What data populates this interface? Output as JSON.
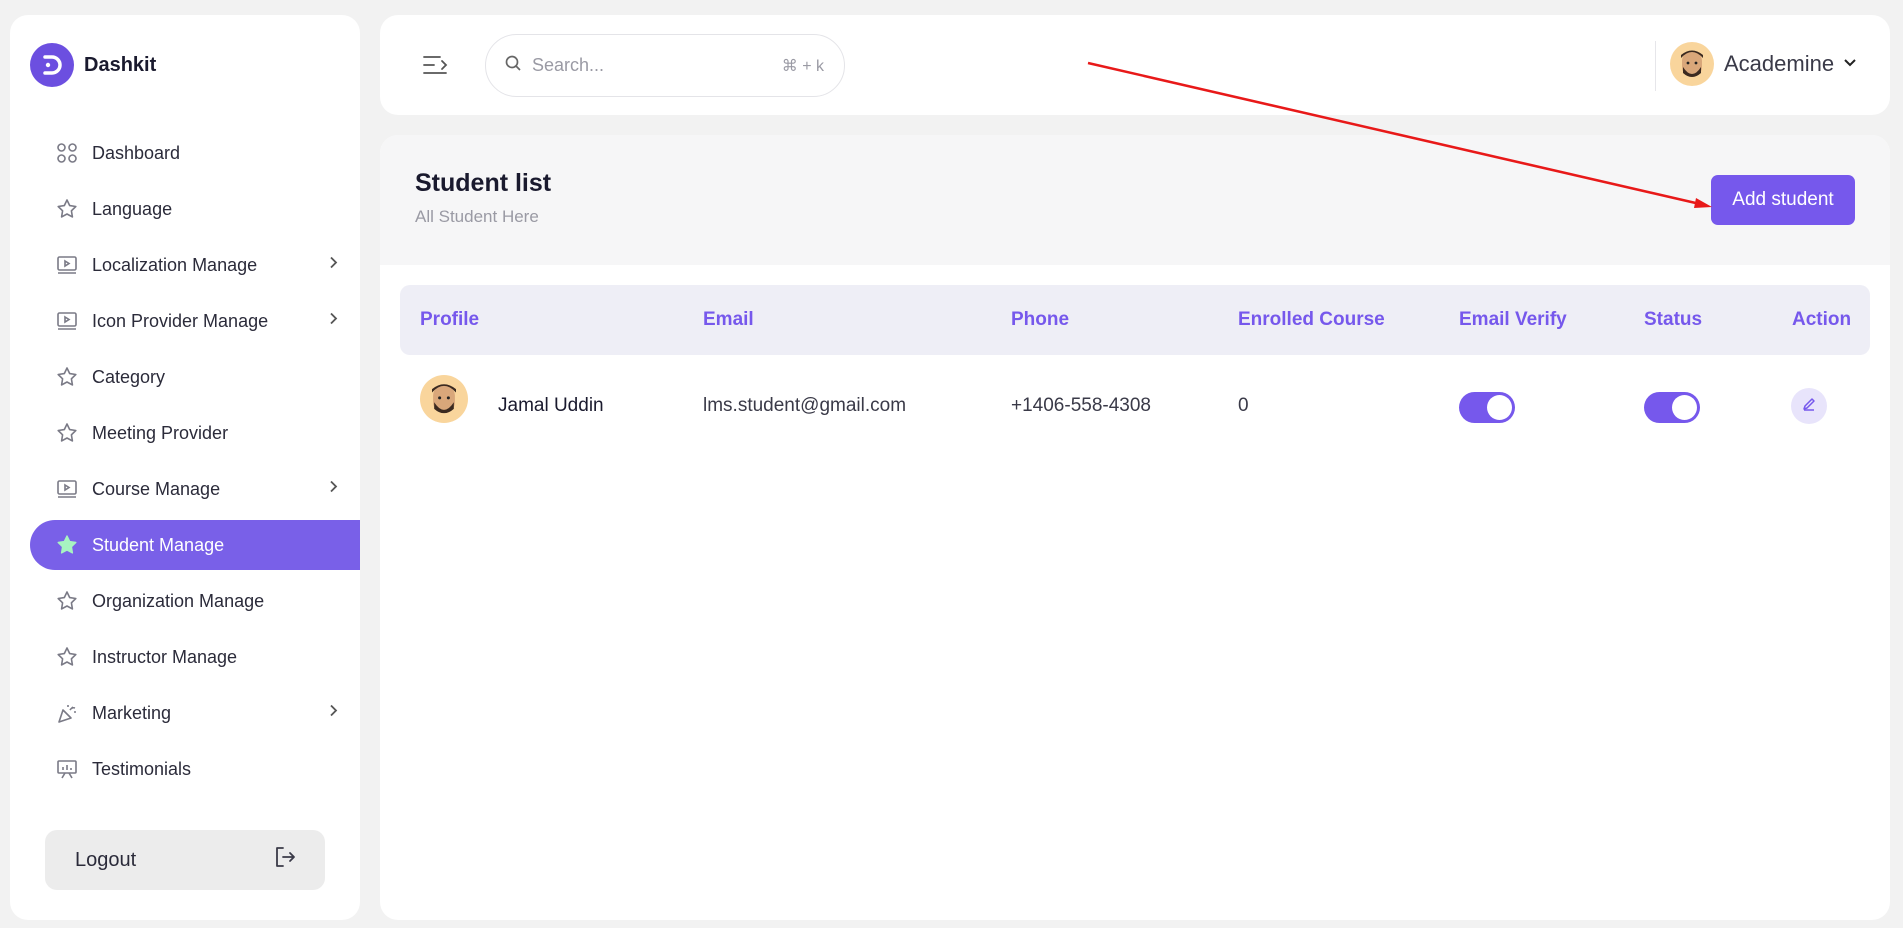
{
  "brand": {
    "name": "Dashkit",
    "color": "#6c4fe0"
  },
  "sidebar": {
    "items": [
      {
        "label": "Dashboard",
        "icon": "grid-icon",
        "has_submenu": false,
        "active": false
      },
      {
        "label": "Language",
        "icon": "star-icon",
        "has_submenu": false,
        "active": false
      },
      {
        "label": "Localization Manage",
        "icon": "monitor-play-icon",
        "has_submenu": true,
        "active": false
      },
      {
        "label": "Icon Provider Manage",
        "icon": "monitor-play-icon",
        "has_submenu": true,
        "active": false
      },
      {
        "label": "Category",
        "icon": "star-icon",
        "has_submenu": false,
        "active": false
      },
      {
        "label": "Meeting Provider",
        "icon": "star-icon",
        "has_submenu": false,
        "active": false
      },
      {
        "label": "Course Manage",
        "icon": "monitor-play-icon",
        "has_submenu": true,
        "active": false
      },
      {
        "label": "Student Manage",
        "icon": "star-icon",
        "has_submenu": false,
        "active": true
      },
      {
        "label": "Organization Manage",
        "icon": "star-icon",
        "has_submenu": false,
        "active": false
      },
      {
        "label": "Instructor Manage",
        "icon": "star-icon",
        "has_submenu": false,
        "active": false
      },
      {
        "label": "Marketing",
        "icon": "party-popper-icon",
        "has_submenu": true,
        "active": false
      },
      {
        "label": "Testimonials",
        "icon": "presentation-icon",
        "has_submenu": false,
        "active": false
      }
    ],
    "logout_label": "Logout"
  },
  "topbar": {
    "search_placeholder": "Search...",
    "search_shortcut": "⌘ + k",
    "user_name": "Academine"
  },
  "page": {
    "title": "Student list",
    "subtitle": "All Student Here",
    "add_button_label": "Add student"
  },
  "table": {
    "headers": [
      "Profile",
      "Email",
      "Phone",
      "Enrolled Course",
      "Email Verify",
      "Status",
      "Action"
    ],
    "rows": [
      {
        "name": "Jamal Uddin",
        "email": "lms.student@gmail.com",
        "phone": "+1406-558-4308",
        "enrolled_course": "0",
        "email_verify": true,
        "status": true
      }
    ]
  },
  "colors": {
    "accent": "#7658ec",
    "active_nav": "#7960e8",
    "annotation_arrow": "#e81919"
  }
}
